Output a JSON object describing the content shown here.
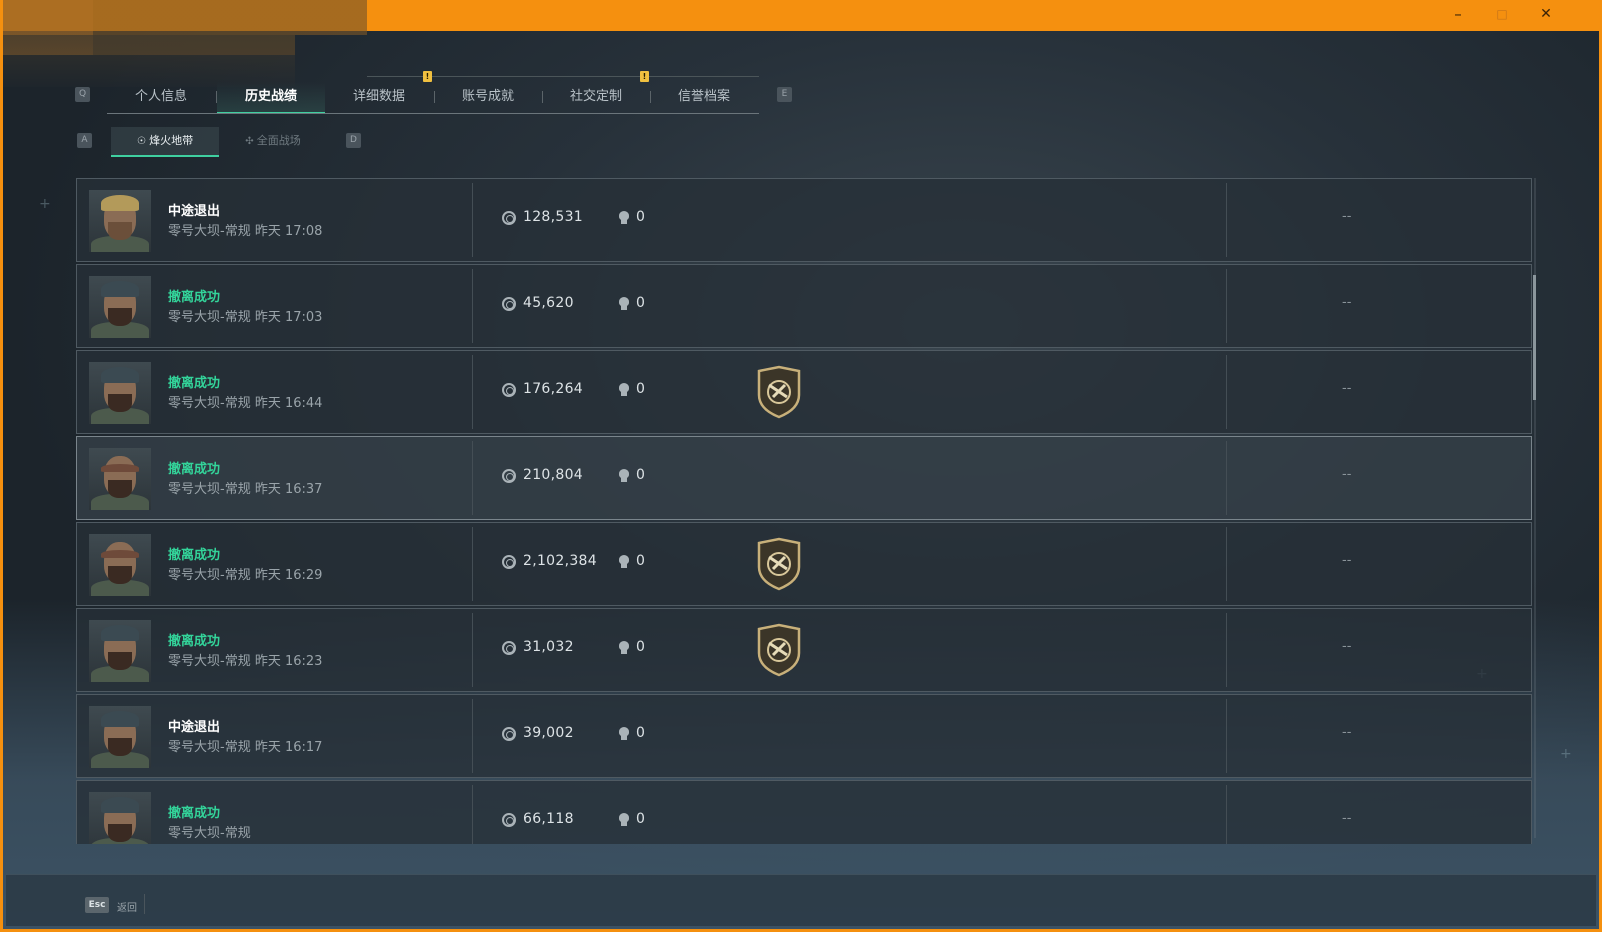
{
  "window": {
    "controls": {
      "minimize": "–",
      "maximize": "□",
      "close": "✕"
    },
    "accent_color": "#f5900f"
  },
  "tabs": {
    "prev_key": "Q",
    "next_key": "E",
    "items": [
      {
        "label": "个人信息",
        "active": false
      },
      {
        "label": "历史战绩",
        "active": true
      },
      {
        "label": "详细数据",
        "active": false,
        "notif": "!"
      },
      {
        "label": "账号成就",
        "active": false
      },
      {
        "label": "社交定制",
        "active": false,
        "notif": "!"
      },
      {
        "label": "信誉档案",
        "active": false
      }
    ]
  },
  "subtabs": {
    "prev_key": "A",
    "next_key": "D",
    "items": [
      {
        "label": "烽火地带",
        "icon": "extraction-icon",
        "active": true
      },
      {
        "label": "全面战场",
        "icon": "battlefield-icon",
        "active": false
      }
    ]
  },
  "records": [
    {
      "status": "中途退出",
      "ok": false,
      "map": "零号大坝-常规",
      "time": "昨天 17:08",
      "value": "128,531",
      "kills": "0",
      "badge": null,
      "extra": "--",
      "avatar": "blonde-operator"
    },
    {
      "status": "撤离成功",
      "ok": true,
      "map": "零号大坝-常规",
      "time": "昨天 17:03",
      "value": "45,620",
      "kills": "0",
      "badge": null,
      "extra": "--",
      "avatar": "cap-operator"
    },
    {
      "status": "撤离成功",
      "ok": true,
      "map": "零号大坝-常规",
      "time": "昨天 16:44",
      "value": "176,264",
      "kills": "0",
      "badge": "shield-gun-badge",
      "extra": "--",
      "avatar": "cap-operator"
    },
    {
      "status": "撤离成功",
      "ok": true,
      "map": "零号大坝-常规",
      "time": "昨天 16:37",
      "value": "210,804",
      "kills": "0",
      "badge": null,
      "extra": "--",
      "avatar": "goggles-operator"
    },
    {
      "status": "撤离成功",
      "ok": true,
      "map": "零号大坝-常规",
      "time": "昨天 16:29",
      "value": "2,102,384",
      "kills": "0",
      "badge": "shield-gun-badge",
      "extra": "--",
      "avatar": "goggles-operator"
    },
    {
      "status": "撤离成功",
      "ok": true,
      "map": "零号大坝-常规",
      "time": "昨天 16:23",
      "value": "31,032",
      "kills": "0",
      "badge": "shield-gun-badge",
      "extra": "--",
      "avatar": "cap-operator"
    },
    {
      "status": "中途退出",
      "ok": false,
      "map": "零号大坝-常规",
      "time": "昨天 16:17",
      "value": "39,002",
      "kills": "0",
      "badge": null,
      "extra": "--",
      "avatar": "cap-operator"
    },
    {
      "status": "撤离成功",
      "ok": true,
      "map": "零号大坝-常规",
      "time": "",
      "value": "66,118",
      "kills": "0",
      "badge": null,
      "extra": "--",
      "avatar": "cap-operator"
    }
  ],
  "footer": {
    "esc_key": "Esc",
    "back_label": "返回"
  }
}
